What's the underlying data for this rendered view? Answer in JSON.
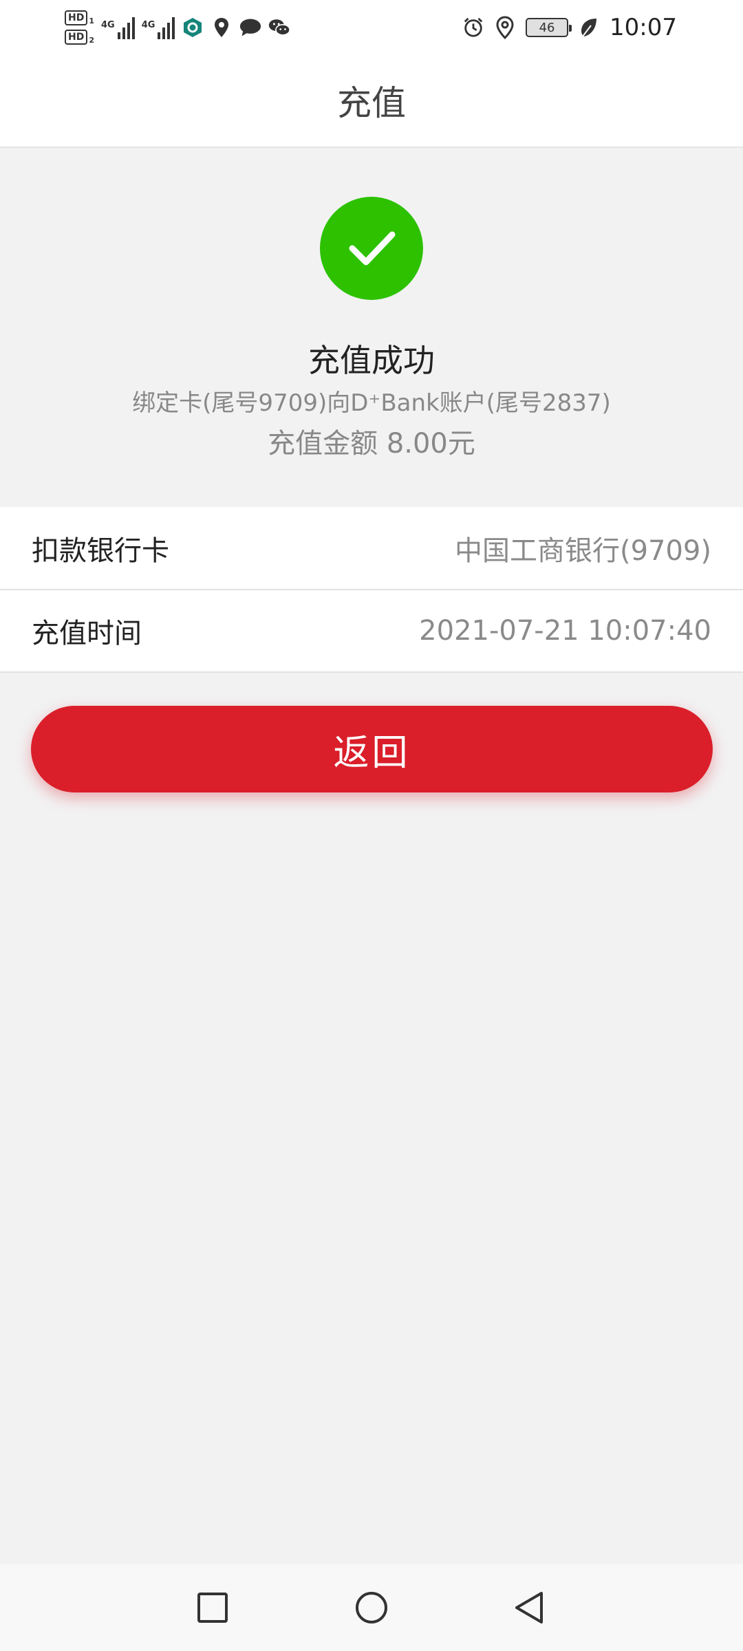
{
  "status_bar": {
    "sim1_label": "HD",
    "sim1_index": "1",
    "sim2_label": "HD",
    "sim2_index": "2",
    "network1": "4G",
    "network2": "4G",
    "battery_level": "46",
    "time": "10:07",
    "icons": [
      "hd-icon",
      "signal-icon",
      "app-icon",
      "location-pin-icon",
      "message-icon",
      "wechat-icon",
      "alarm-icon",
      "location-icon",
      "battery-icon",
      "leaf-icon"
    ]
  },
  "header": {
    "title": "充值"
  },
  "success": {
    "icon": "check-circle-icon",
    "title": "充值成功",
    "description": "绑定卡(尾号9709)向D⁺Bank账户(尾号2837)",
    "amount": "充值金额 8.00元",
    "color": "#2dc100"
  },
  "details": [
    {
      "label": "扣款银行卡",
      "value": "中国工商银行(9709)"
    },
    {
      "label": "充值时间",
      "value": "2021-07-21 10:07:40"
    }
  ],
  "actions": {
    "back_label": "返回",
    "back_color": "#da1f2a"
  },
  "nav_bar": {
    "items": [
      "recents-square-icon",
      "home-circle-icon",
      "back-triangle-icon"
    ]
  }
}
